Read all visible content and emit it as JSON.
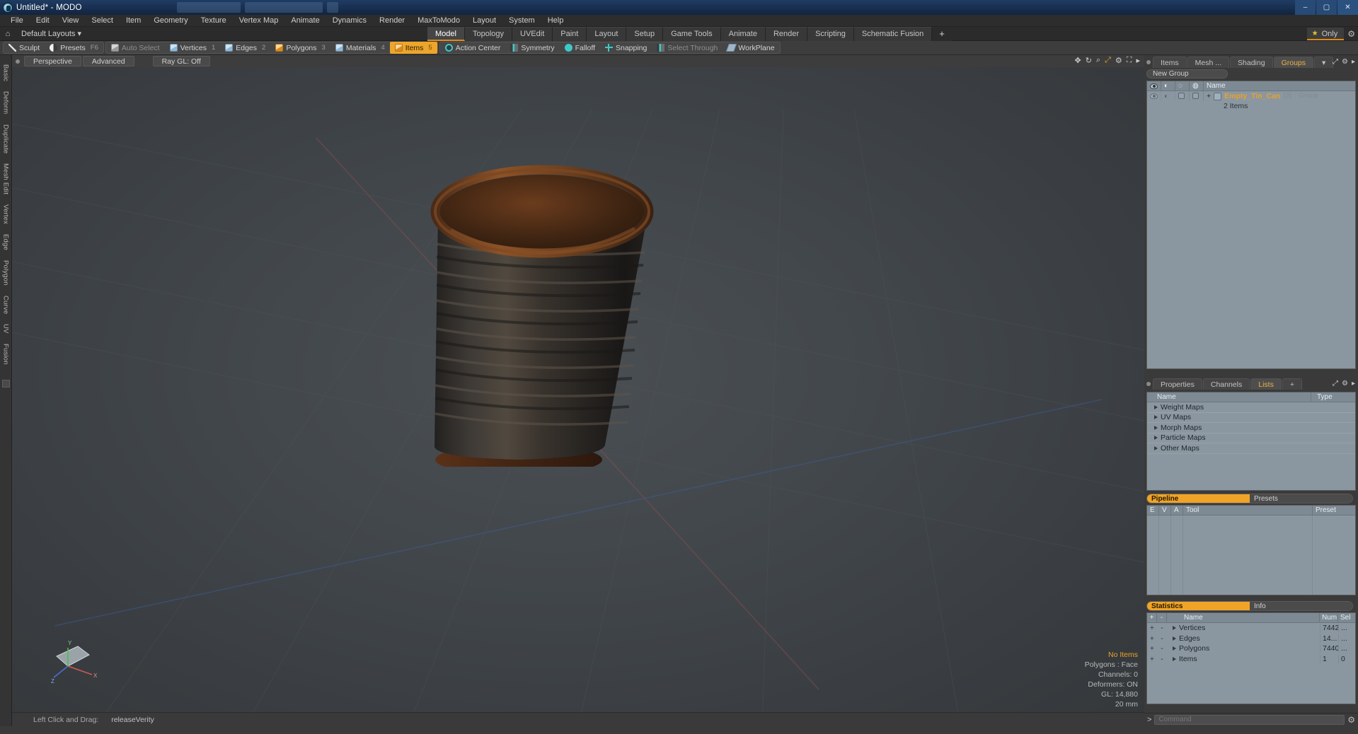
{
  "window": {
    "title": "Untitled* - MODO",
    "app_icon": "modo-logo-icon",
    "minimize": "–",
    "maximize": "▢",
    "close": "✕"
  },
  "menu": {
    "items": [
      "File",
      "Edit",
      "View",
      "Select",
      "Item",
      "Geometry",
      "Texture",
      "Vertex Map",
      "Animate",
      "Dynamics",
      "Render",
      "MaxToModo",
      "Layout",
      "System",
      "Help"
    ]
  },
  "layout_bar": {
    "home_icon": "home-icon",
    "preset_label": "Default Layouts",
    "preset_caret": "▾",
    "tabs": [
      {
        "label": "Model",
        "active": true
      },
      {
        "label": "Topology",
        "active": false
      },
      {
        "label": "UVEdit",
        "active": false
      },
      {
        "label": "Paint",
        "active": false
      },
      {
        "label": "Layout",
        "active": false
      },
      {
        "label": "Setup",
        "active": false
      },
      {
        "label": "Game Tools",
        "active": false
      },
      {
        "label": "Animate",
        "active": false
      },
      {
        "label": "Render",
        "active": false
      },
      {
        "label": "Scripting",
        "active": false
      },
      {
        "label": "Schematic Fusion",
        "active": false
      }
    ],
    "add_tab": "+",
    "only_label": "Only",
    "star_icon": "star-icon",
    "gear_icon": "gear-icon"
  },
  "mode_toolbar": {
    "groups": [
      {
        "buttons": [
          {
            "label": "Sculpt",
            "icon": "brush-icon",
            "badge": "",
            "state": "normal"
          },
          {
            "label": "Presets",
            "icon": "sphere-half-icon",
            "badge": "F6",
            "state": "normal"
          }
        ]
      },
      {
        "buttons": [
          {
            "label": "Auto Select",
            "icon": "cube-grey-icon",
            "badge": "",
            "state": "dim"
          },
          {
            "label": "Vertices",
            "icon": "cube-vertex-icon",
            "badge": "1",
            "state": "normal"
          },
          {
            "label": "Edges",
            "icon": "cube-edge-icon",
            "badge": "2",
            "state": "normal"
          },
          {
            "label": "Polygons",
            "icon": "cube-polygon-icon",
            "badge": "3",
            "state": "normal"
          },
          {
            "label": "Materials",
            "icon": "cube-material-icon",
            "badge": "4",
            "state": "normal"
          },
          {
            "label": "Items",
            "icon": "cube-item-icon",
            "badge": "5",
            "state": "active"
          }
        ]
      },
      {
        "buttons": [
          {
            "label": "Action Center",
            "icon": "action-center-icon",
            "badge": "",
            "state": "normal"
          },
          {
            "label": "Symmetry",
            "icon": "symmetry-icon",
            "badge": "",
            "state": "normal"
          },
          {
            "label": "Falloff",
            "icon": "falloff-icon",
            "badge": "",
            "state": "normal"
          },
          {
            "label": "Snapping",
            "icon": "snapping-icon",
            "badge": "",
            "state": "normal"
          },
          {
            "label": "Select Through",
            "icon": "select-through-icon",
            "badge": "",
            "state": "dim"
          },
          {
            "label": "WorkPlane",
            "icon": "workplane-icon",
            "badge": "",
            "state": "normal"
          }
        ]
      }
    ]
  },
  "left_rail": {
    "items": [
      "Basic",
      "Deform",
      "Duplicate",
      "Mesh Edit",
      "Vertex",
      "Edge",
      "Polygon",
      "Curve",
      "UV",
      "Fusion"
    ]
  },
  "viewport": {
    "header": {
      "view_label": "Perspective",
      "shading_label": "Advanced",
      "raygl_label": "Ray GL: Off",
      "icons": [
        "move-icon",
        "rotate-icon",
        "zoom-icon",
        "fit-icon",
        "gear-icon",
        "expand-icon",
        "menu-icon"
      ]
    },
    "stats": {
      "selection": "No Items",
      "polygons": "Polygons : Face",
      "channels": "Channels: 0",
      "deformers": "Deformers: ON",
      "gl": "GL: 14,880",
      "grid": "20 mm"
    },
    "status": {
      "hint_label": "Left Click and Drag:",
      "hint_value": "releaseVerity"
    },
    "gizmo": {
      "x": "X",
      "y": "Y",
      "z": "Z"
    }
  },
  "groups_panel": {
    "tabs": [
      {
        "label": "Items",
        "active": false
      },
      {
        "label": "Mesh ...",
        "active": false
      },
      {
        "label": "Shading",
        "active": false
      },
      {
        "label": "Groups",
        "active": true
      }
    ],
    "caret": "▾",
    "new_group_label": "New Group",
    "columns": [
      "Name"
    ],
    "col_icons": [
      "eye-icon",
      "render-icon",
      "lock-icon",
      "wire-icon"
    ],
    "rows": [
      {
        "name": "Empty_Tin_Can",
        "count": "(3)",
        "type": ": Group",
        "sub": "2 Items",
        "expander": "+"
      }
    ]
  },
  "lists_panel": {
    "tabs": [
      {
        "label": "Properties",
        "active": false
      },
      {
        "label": "Channels",
        "active": false
      },
      {
        "label": "Lists",
        "active": true
      }
    ],
    "add_tab": "+",
    "columns": [
      "Name",
      "Type"
    ],
    "rows": [
      {
        "name": "Weight Maps",
        "type": ""
      },
      {
        "name": "UV Maps",
        "type": ""
      },
      {
        "name": "Morph Maps",
        "type": ""
      },
      {
        "name": "Particle Maps",
        "type": ""
      },
      {
        "name": "Other Maps",
        "type": ""
      }
    ]
  },
  "pipeline_panel": {
    "tabs": [
      {
        "label": "Pipeline",
        "active": true
      },
      {
        "label": "Presets",
        "active": false
      }
    ],
    "columns": [
      "E",
      "V",
      "A",
      "Tool",
      "Preset"
    ],
    "rows": []
  },
  "statistics_panel": {
    "tabs": [
      {
        "label": "Statistics",
        "active": true
      },
      {
        "label": "Info",
        "active": false
      }
    ],
    "columns": [
      "+",
      "-",
      "Name",
      "Num",
      "Sel"
    ],
    "rows": [
      {
        "name": "Vertices",
        "num": "7442",
        "sel": "..."
      },
      {
        "name": "Edges",
        "num": "14...",
        "sel": "..."
      },
      {
        "name": "Polygons",
        "num": "7440",
        "sel": "..."
      },
      {
        "name": "Items",
        "num": "1",
        "sel": "0"
      }
    ]
  },
  "command_bar": {
    "prompt": ">",
    "placeholder": "Command",
    "value": "",
    "gear_icon": "gear-icon"
  },
  "colors": {
    "accent": "#eda52b",
    "panel_bg": "#3a3a3a",
    "table_bg": "#8b97a0",
    "group_name": "#e9a12a",
    "x_axis": "#b5615e",
    "z_axis": "#3c62b8"
  }
}
